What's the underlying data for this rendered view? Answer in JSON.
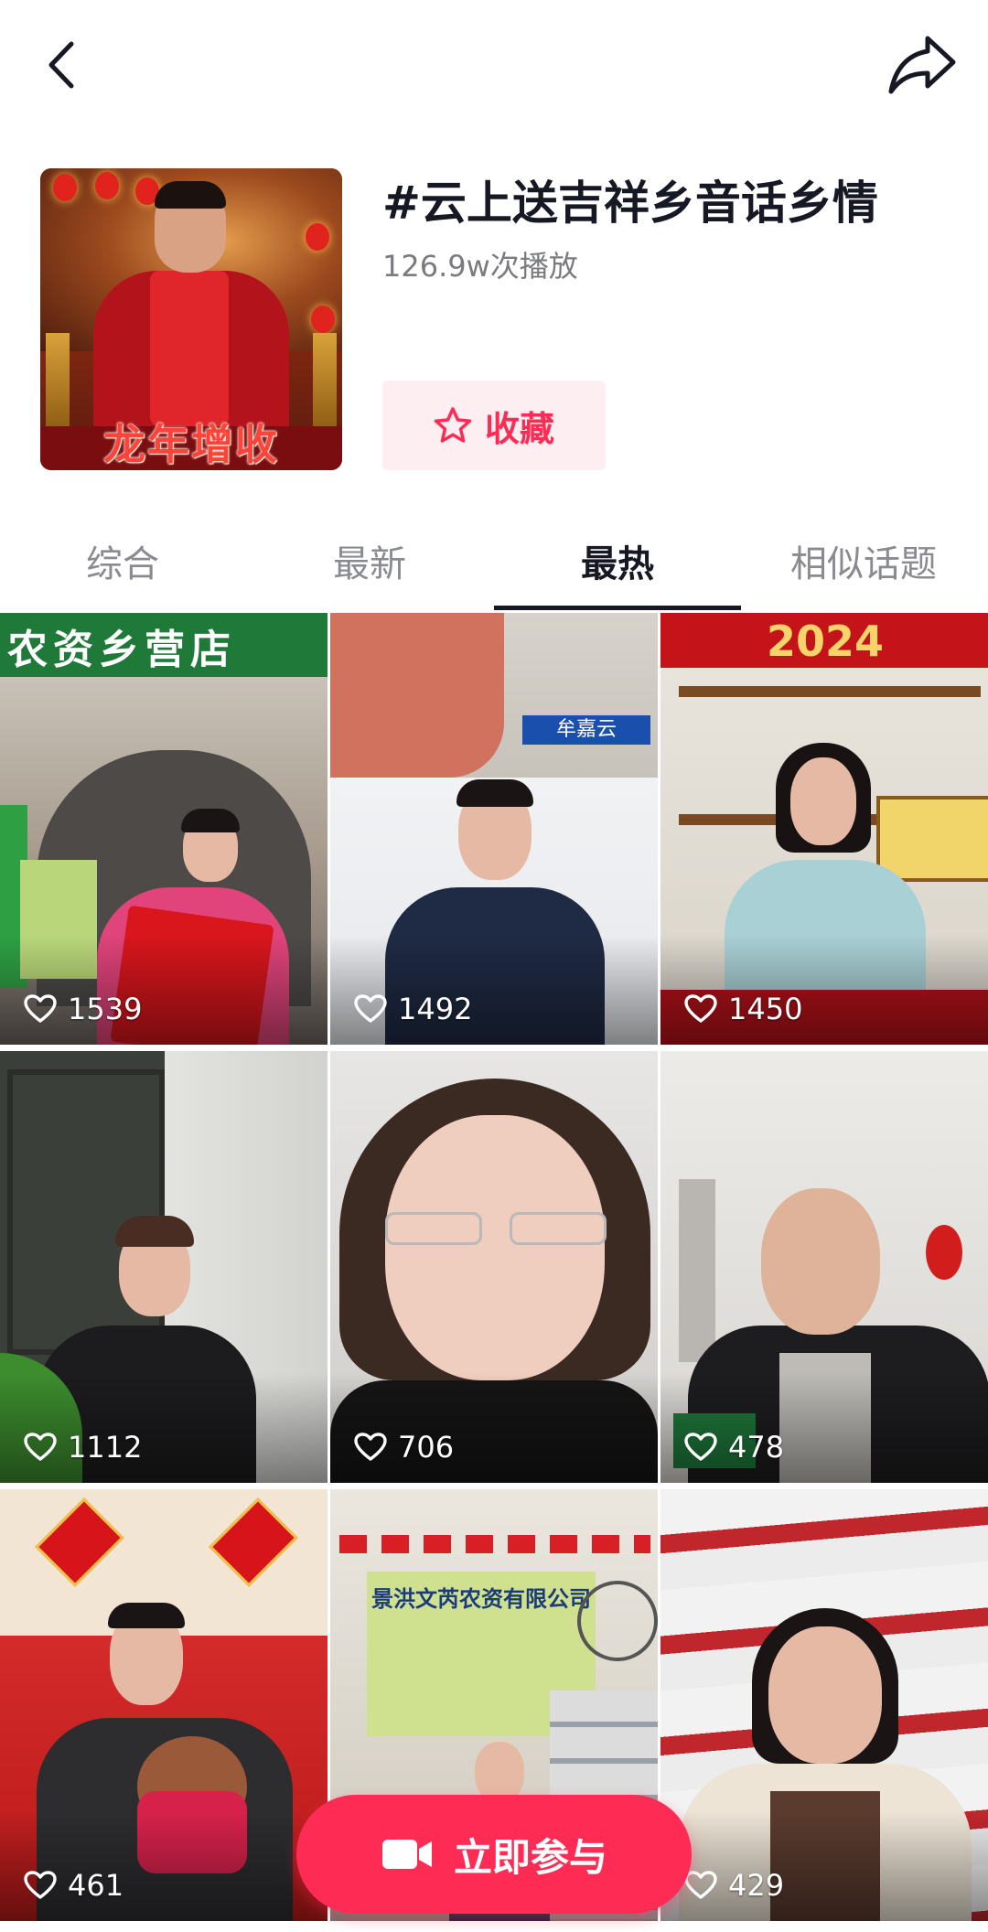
{
  "header": {
    "back_icon": "chevron-left-icon",
    "share_icon": "share-arrow-icon"
  },
  "topic": {
    "title": "#云上送吉祥乡音话乡情",
    "play_count": "126.9w次播放",
    "favorite_label": "收藏",
    "cover_caption": "龙年增收"
  },
  "tabs": [
    {
      "label": "综合",
      "active": false
    },
    {
      "label": "最新",
      "active": false
    },
    {
      "label": "最热",
      "active": true
    },
    {
      "label": "相似话题",
      "active": false
    }
  ],
  "videos": [
    {
      "likes": "1539",
      "overlay_text": "农资乡营店"
    },
    {
      "likes": "1492",
      "overlay_text": "牟嘉云"
    },
    {
      "likes": "1450",
      "overlay_text": "2024"
    },
    {
      "likes": "1112"
    },
    {
      "likes": "706"
    },
    {
      "likes": "478"
    },
    {
      "likes": "461"
    },
    {
      "likes": "429"
    },
    {
      "likes": "",
      "overlay_text": "景洪文芮农资有限公司"
    }
  ],
  "join_button": {
    "label": "立即参与",
    "icon": "video-camera-icon"
  },
  "colors": {
    "accent": "#fe2c55",
    "accent_bg": "#fdeff1",
    "text_primary": "#161823",
    "text_secondary": "#8a8b91"
  }
}
